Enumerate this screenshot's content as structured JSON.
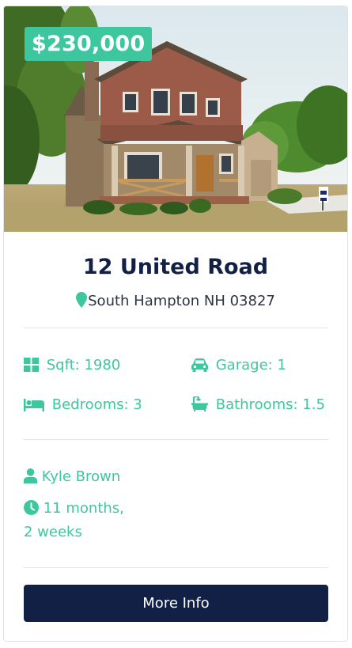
{
  "listing": {
    "price": "$230,000",
    "title": "12 United Road",
    "address": "South Hampton NH 03827",
    "features": {
      "sqft": "Sqft: 1980",
      "garage": "Garage: 1",
      "bedrooms": "Bedrooms: 3",
      "bathrooms": "Bathrooms: 1.5"
    },
    "agent": "Kyle Brown",
    "age_line1": "11 months,",
    "age_line2": "2 weeks",
    "button_label": "More Info"
  },
  "colors": {
    "accent": "#3ec79e",
    "navy": "#132046"
  },
  "icons": [
    "map-marker-icon",
    "th-large-icon",
    "car-icon",
    "bed-icon",
    "bath-icon",
    "user-icon",
    "clock-icon"
  ]
}
